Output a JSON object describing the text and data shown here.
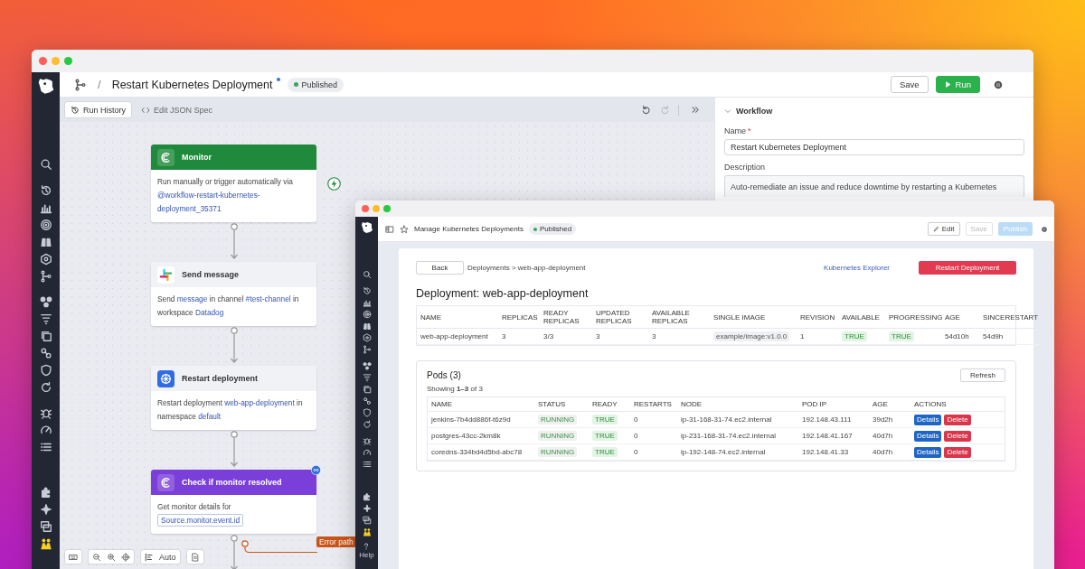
{
  "workflow_window": {
    "separator": "/",
    "title": "Restart Kubernetes Deployment",
    "unsaved": true,
    "status_badge": "Published",
    "header_buttons": [
      {
        "label": "Save",
        "kind": "secondary"
      },
      {
        "label": "Run",
        "kind": "primary"
      }
    ],
    "toolbar": [
      {
        "label": "Run History",
        "kind": "button"
      },
      {
        "label": "Edit JSON Spec",
        "kind": "link"
      }
    ],
    "nodes": [
      {
        "kind": "monitor",
        "title": "Monitor",
        "color": "#1f8a3b",
        "loop_badge": false,
        "description": [
          {
            "kind": "text",
            "text": "Run manually or trigger automatically via "
          },
          {
            "kind": "link",
            "text": "@workflow-restart-kubernetes-"
          },
          {
            "kind": "link",
            "text": "deployment_35371"
          }
        ]
      },
      {
        "kind": "slack",
        "title": "Send message",
        "color": "#f1f2f6",
        "loop_badge": false,
        "description": [
          {
            "kind": "text",
            "text": "Send "
          },
          {
            "kind": "link",
            "text": "message"
          },
          {
            "kind": "text",
            "text": " in channel "
          },
          {
            "kind": "link",
            "text": "#test-channel"
          },
          {
            "kind": "text",
            "text": " in workspace "
          },
          {
            "kind": "link",
            "text": "Datadog"
          }
        ]
      },
      {
        "kind": "kubernetes",
        "title": "Restart deployment",
        "color": "#f1f2f6",
        "loop_badge": false,
        "description": [
          {
            "kind": "text",
            "text": "Restart deployment "
          },
          {
            "kind": "link",
            "text": "web-app-deployment"
          },
          {
            "kind": "text",
            "text": " in namespace "
          },
          {
            "kind": "link",
            "text": "default"
          }
        ]
      },
      {
        "kind": "monitor",
        "title": "Check if monitor resolved",
        "color": "#7a3fd8",
        "loop_badge": true,
        "description": [
          {
            "kind": "text",
            "text": "Get monitor details for "
          },
          {
            "kind": "code",
            "text": "Source.monitor.event.id"
          }
        ]
      }
    ],
    "error_path": "Error path",
    "auto_button": "Auto",
    "panel": {
      "section": "Workflow",
      "expanded": true,
      "name_label": "Name",
      "required_mark": "*",
      "name_value": "Restart Kubernetes Deployment",
      "description_label": "Description",
      "description_value": "Auto-remediate an issue and reduce downtime by restarting a Kubernetes"
    }
  },
  "app_window": {
    "title": "Manage Kubernetes Deployments",
    "status_badge": "Published",
    "header_buttons": [
      {
        "label": "Edit",
        "kind": "secondary",
        "disabled": false
      },
      {
        "label": "Save",
        "kind": "secondary",
        "disabled": true
      },
      {
        "label": "Publish",
        "kind": "primary",
        "disabled": true
      }
    ],
    "back_button": "Back",
    "breadcrumb": "Deployments > web-app-deployment",
    "explorer_link": "Kubernetes Explorer",
    "restart_button": "Restart Deployment",
    "heading": "Deployment: web-app-deployment",
    "deployment_table": {
      "columns": [
        "NAME",
        "REPLICAS",
        "READY REPLICAS",
        "UPDATED REPLICAS",
        "AVAILABLE REPLICAS",
        "SINGLE IMAGE",
        "REVISION",
        "AVAILABLE",
        "PROGRESSING",
        "AGE",
        "SINCERESTART"
      ],
      "rows": [
        [
          {
            "kind": "text",
            "text": "web-app-deployment"
          },
          {
            "kind": "text",
            "text": "3"
          },
          {
            "kind": "text",
            "text": "3/3"
          },
          {
            "kind": "text",
            "text": "3"
          },
          {
            "kind": "text",
            "text": "3"
          },
          {
            "kind": "code",
            "text": "example/image:v1.0.0"
          },
          {
            "kind": "text",
            "text": "1"
          },
          {
            "kind": "ok",
            "text": "TRUE"
          },
          {
            "kind": "ok",
            "text": "TRUE"
          },
          {
            "kind": "text",
            "text": "54d10h"
          },
          {
            "kind": "text",
            "text": "54d9h"
          }
        ]
      ]
    },
    "pods": {
      "title": "Pods (3)",
      "refresh_button": "Refresh",
      "showing": "Showing **1–3** of 3",
      "columns": [
        "NAME",
        "STATUS",
        "READY",
        "RESTARTS",
        "NODE",
        "POD IP",
        "AGE",
        "ACTIONS"
      ],
      "rows": [
        {
          "cells": [
            {
              "kind": "text",
              "text": "jenkins-7b4dd886f-t6z9d"
            },
            {
              "kind": "running",
              "text": "RUNNING"
            },
            {
              "kind": "ok",
              "text": "TRUE"
            },
            {
              "kind": "text",
              "text": "0"
            },
            {
              "kind": "text",
              "text": "ip-31-168-31-74.ec2.internal"
            },
            {
              "kind": "text",
              "text": "192.148.43.111"
            },
            {
              "kind": "text",
              "text": "39d2h"
            }
          ],
          "actions": [
            {
              "kind": "primary",
              "label": "Details"
            },
            {
              "kind": "danger",
              "label": "Delete"
            }
          ]
        },
        {
          "cells": [
            {
              "kind": "text",
              "text": "postgres-43cc-2km8k"
            },
            {
              "kind": "running",
              "text": "RUNNING"
            },
            {
              "kind": "ok",
              "text": "TRUE"
            },
            {
              "kind": "text",
              "text": "0"
            },
            {
              "kind": "text",
              "text": "ip-231-168-31-74.ec2.internal"
            },
            {
              "kind": "text",
              "text": "192.148.41.167"
            },
            {
              "kind": "text",
              "text": "40d7h"
            }
          ],
          "actions": [
            {
              "kind": "primary",
              "label": "Details"
            },
            {
              "kind": "danger",
              "label": "Delete"
            }
          ]
        },
        {
          "cells": [
            {
              "kind": "text",
              "text": "coredns-334bd4d5bd-abc78"
            },
            {
              "kind": "running",
              "text": "RUNNING"
            },
            {
              "kind": "ok",
              "text": "TRUE"
            },
            {
              "kind": "text",
              "text": "0"
            },
            {
              "kind": "text",
              "text": "ip-192-148-74.ec2.internal"
            },
            {
              "kind": "text",
              "text": "192.148.41.33"
            },
            {
              "kind": "text",
              "text": "40d7h"
            }
          ],
          "actions": [
            {
              "kind": "primary",
              "label": "Details"
            },
            {
              "kind": "danger",
              "label": "Delete"
            }
          ]
        }
      ]
    },
    "help_label": "Help"
  }
}
